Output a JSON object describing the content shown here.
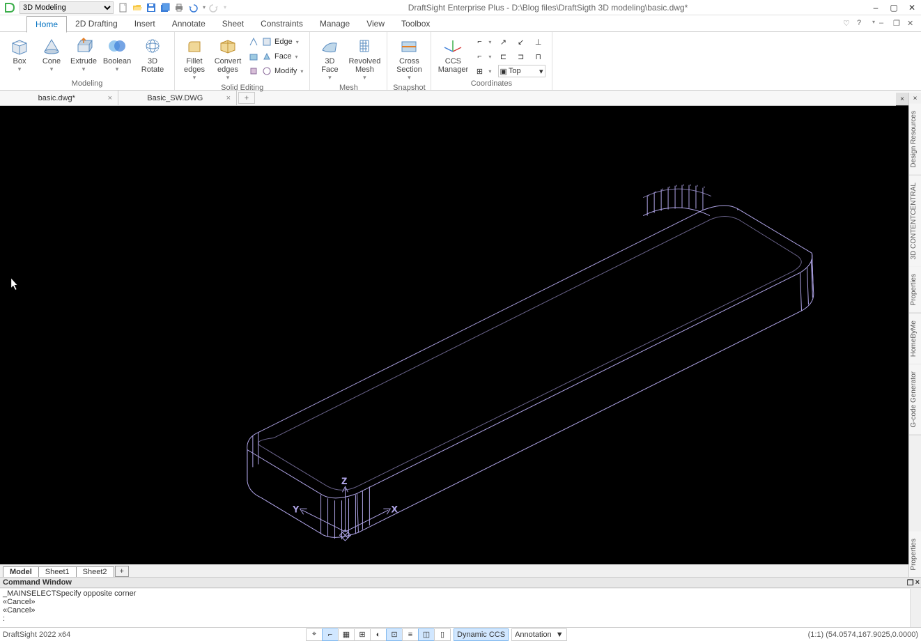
{
  "title": "DraftSight Enterprise Plus - D:\\Blog files\\DraftSigth 3D modeling\\basic.dwg*",
  "workspace": "3D Modeling",
  "menu_tabs": [
    "Home",
    "2D Drafting",
    "Insert",
    "Annotate",
    "Sheet",
    "Constraints",
    "Manage",
    "View",
    "Toolbox"
  ],
  "ribbon": {
    "modeling": {
      "title": "Modeling",
      "box": "Box",
      "cone": "Cone",
      "extrude": "Extrude",
      "boolean": "Boolean",
      "rotate3d": "3D Rotate"
    },
    "solid_editing": {
      "title": "Solid Editing",
      "fillet": "Fillet\nedges",
      "convert": "Convert\nedges",
      "edge": "Edge",
      "face": "Face",
      "modify": "Modify"
    },
    "mesh": {
      "title": "Mesh",
      "face3d": "3D Face",
      "revolved": "Revolved\nMesh"
    },
    "snapshot": {
      "title": "Snapshot",
      "cross": "Cross\nSection"
    },
    "coords": {
      "title": "Coordinates",
      "ccs": "CCS\nManager",
      "top": "Top"
    }
  },
  "doc_tabs": [
    {
      "label": "basic.dwg*"
    },
    {
      "label": "Basic_SW.DWG"
    }
  ],
  "right_panels": [
    "Design Resources",
    "3D CONTENTCENTRAL",
    "Properties",
    "HomeByMe",
    "G-code Generator",
    "Properties"
  ],
  "sheets": [
    "Model",
    "Sheet1",
    "Sheet2"
  ],
  "cmd": {
    "title": "Command Window",
    "lines": [
      "_MAINSELECTSpecify opposite corner",
      "«Cancel»",
      "«Cancel»"
    ],
    "prompt": ":"
  },
  "status": {
    "left": "DraftSight 2022 x64",
    "dynccs": "Dynamic CCS",
    "annotation": "Annotation",
    "coords": "(1:1)  (54.0574,167.9025,0.0000)"
  },
  "ucs": {
    "x": "X",
    "y": "Y",
    "z": "Z"
  }
}
